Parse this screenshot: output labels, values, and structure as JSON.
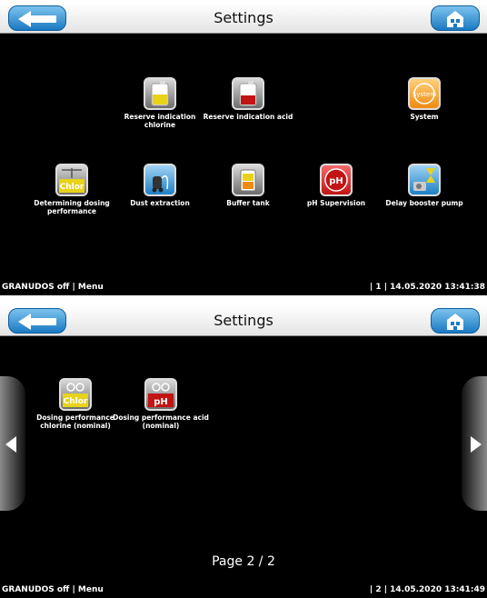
{
  "screens": [
    {
      "title": "Settings",
      "tiles": [
        {
          "label": "Reserve indication chlorine",
          "icon": "chlorine-canister-icon"
        },
        {
          "label": "Reserve indication acid",
          "icon": "acid-canister-icon"
        },
        {
          "label": "System",
          "icon": "system-icon",
          "icon_text": "System"
        },
        {
          "label": "Determining dosing performance",
          "icon": "scale-chlor-icon",
          "icon_text": "Chlor"
        },
        {
          "label": "Dust extraction",
          "icon": "vacuum-icon"
        },
        {
          "label": "Buffer tank",
          "icon": "buffer-tank-icon"
        },
        {
          "label": "pH Supervision",
          "icon": "ph-icon",
          "icon_text": "pH"
        },
        {
          "label": "Delay booster pump",
          "icon": "hourglass-pump-icon"
        }
      ],
      "status_left": "GRANUDOS off | Menu",
      "status_right": "| 1 | 14.05.2020 13:41:38"
    },
    {
      "title": "Settings",
      "tiles": [
        {
          "label": "Dosing performance chlorine (nominal)",
          "icon": "chlor-dosing-icon",
          "icon_text": "Chlor"
        },
        {
          "label": "Dosing performance acid (nominal)",
          "icon": "ph-dosing-icon",
          "icon_text": "pH"
        }
      ],
      "page_indicator": "Page 2 / 2",
      "status_left": "GRANUDOS off | Menu",
      "status_right": "| 2 | 14.05.2020 13:41:49"
    }
  ],
  "colors": {
    "accent_blue": "#1b79c2",
    "chlor_yellow": "#e8d21a",
    "acid_red": "#c21414",
    "system_orange": "#ef8b12"
  }
}
